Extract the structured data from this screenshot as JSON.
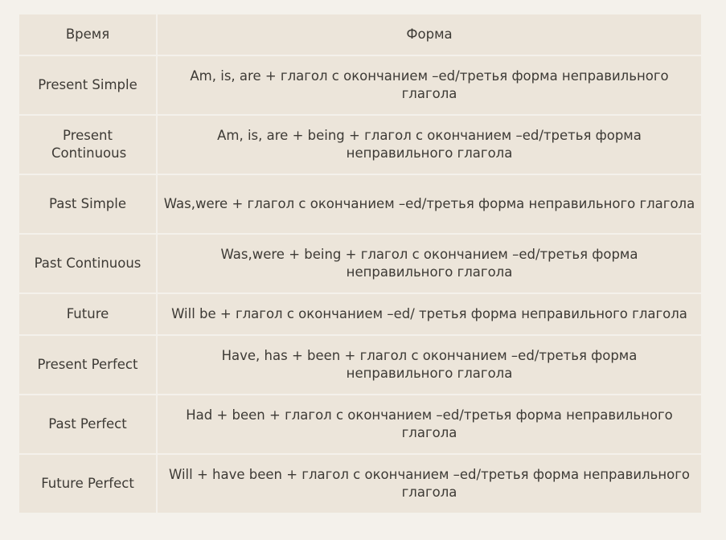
{
  "table": {
    "headers": [
      "Время",
      "Форма"
    ],
    "rows": [
      {
        "tense": "Present Simple",
        "form": "Am, is, are + глагол с окончанием –ed/третья форма неправильного глагола"
      },
      {
        "tense": "Present Continuous",
        "form": "Am, is, are + being + глагол с окончанием –ed/третья форма неправильного глагола"
      },
      {
        "tense": "Past Simple",
        "form": "Was,were + глагол с окончанием –ed/третья форма неправильного глагола"
      },
      {
        "tense": "Past Continuous",
        "form": "Was,were + being + глагол с окончанием –ed/третья форма неправильного глагола"
      },
      {
        "tense": "Future",
        "form": "Will be + глагол с окончанием –ed/ третья форма неправильного глагола"
      },
      {
        "tense": "Present Perfect",
        "form": "Have, has + been + глагол с окончанием –ed/третья форма неправильного глагола"
      },
      {
        "tense": "Past Perfect",
        "form": "Had + been + глагол с окончанием –ed/третья форма неправильного глагола"
      },
      {
        "tense": "Future Perfect",
        "form": "Will + have been + глагол с окончанием –ed/третья форма неправильного глагола"
      }
    ]
  },
  "colors": {
    "page_background": "#f4f1eb",
    "cell_background": "#ece5da",
    "text": "#3d3a35"
  }
}
